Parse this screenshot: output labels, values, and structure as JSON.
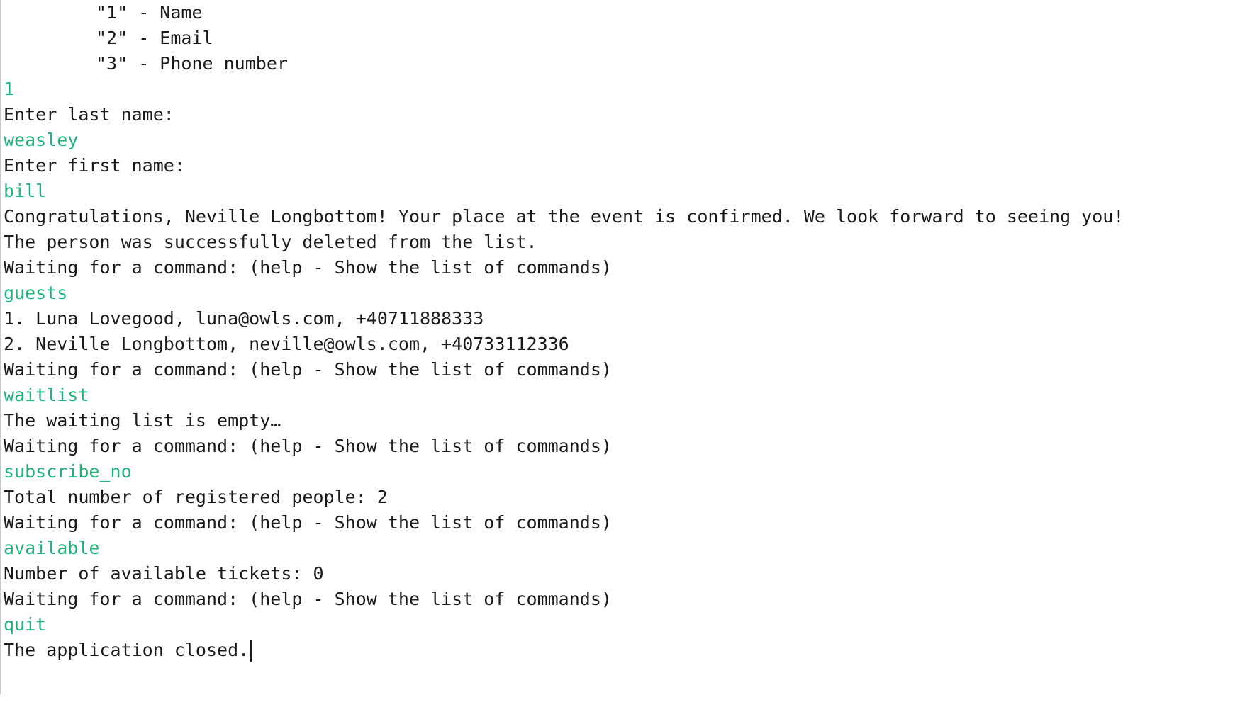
{
  "console": {
    "colors": {
      "output": "#1a1a1a",
      "input": "#1fb37a"
    },
    "lines": [
      {
        "text": "\"1\" - Name",
        "kind": "output",
        "indent": true
      },
      {
        "text": "\"2\" - Email",
        "kind": "output",
        "indent": true
      },
      {
        "text": "\"3\" - Phone number",
        "kind": "output",
        "indent": true
      },
      {
        "text": "1",
        "kind": "input"
      },
      {
        "text": "Enter last name:",
        "kind": "output"
      },
      {
        "text": "weasley",
        "kind": "input"
      },
      {
        "text": "Enter first name:",
        "kind": "output"
      },
      {
        "text": "bill",
        "kind": "input"
      },
      {
        "text": "Congratulations, Neville Longbottom! Your place at the event is confirmed. We look forward to seeing you!",
        "kind": "output"
      },
      {
        "text": "The person was successfully deleted from the list.",
        "kind": "output"
      },
      {
        "text": "Waiting for a command: (help - Show the list of commands)",
        "kind": "output"
      },
      {
        "text": "guests",
        "kind": "input"
      },
      {
        "text": "1. Luna Lovegood, luna@owls.com, +40711888333",
        "kind": "output"
      },
      {
        "text": "2. Neville Longbottom, neville@owls.com, +40733112336",
        "kind": "output"
      },
      {
        "text": "Waiting for a command: (help - Show the list of commands)",
        "kind": "output"
      },
      {
        "text": "waitlist",
        "kind": "input"
      },
      {
        "text": "The waiting list is empty…",
        "kind": "output"
      },
      {
        "text": "Waiting for a command: (help - Show the list of commands)",
        "kind": "output"
      },
      {
        "text": "subscribe_no",
        "kind": "input"
      },
      {
        "text": "Total number of registered people: 2",
        "kind": "output"
      },
      {
        "text": "Waiting for a command: (help - Show the list of commands)",
        "kind": "output"
      },
      {
        "text": "available",
        "kind": "input"
      },
      {
        "text": "Number of available tickets: 0",
        "kind": "output"
      },
      {
        "text": "Waiting for a command: (help - Show the list of commands)",
        "kind": "output"
      },
      {
        "text": "quit",
        "kind": "input"
      },
      {
        "text": "The application closed.",
        "kind": "output",
        "caret": true
      }
    ]
  }
}
